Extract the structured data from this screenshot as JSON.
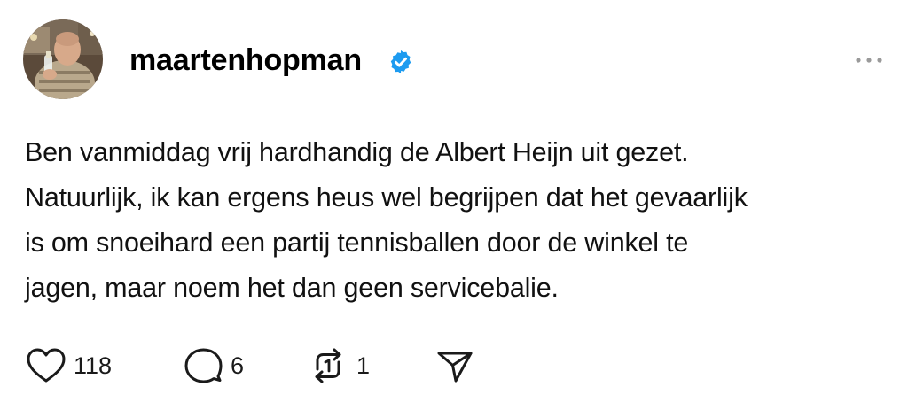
{
  "post": {
    "username": "maartenhopman",
    "verified": true,
    "text_lines": [
      "Ben vanmiddag vrij hardhandig de Albert Heijn uit gezet.",
      "Natuurlijk, ik kan ergens heus wel begrijpen dat het gevaarlijk",
      "is om snoeihard een partij tennisballen door de winkel te",
      "jagen, maar noem het dan geen servicebalie."
    ],
    "actions": {
      "likes": "118",
      "replies": "6",
      "reposts": "1"
    }
  },
  "icons": {
    "verified": "verified-badge-icon",
    "more": "more-options-icon",
    "like": "heart-icon",
    "reply": "speech-bubble-icon",
    "repost": "repost-icon",
    "share": "paper-plane-icon"
  },
  "colors": {
    "verified_badge": "#1D9BF0",
    "text": "#000000",
    "icon": "#1a1a1a",
    "muted": "#9a9a9a"
  }
}
